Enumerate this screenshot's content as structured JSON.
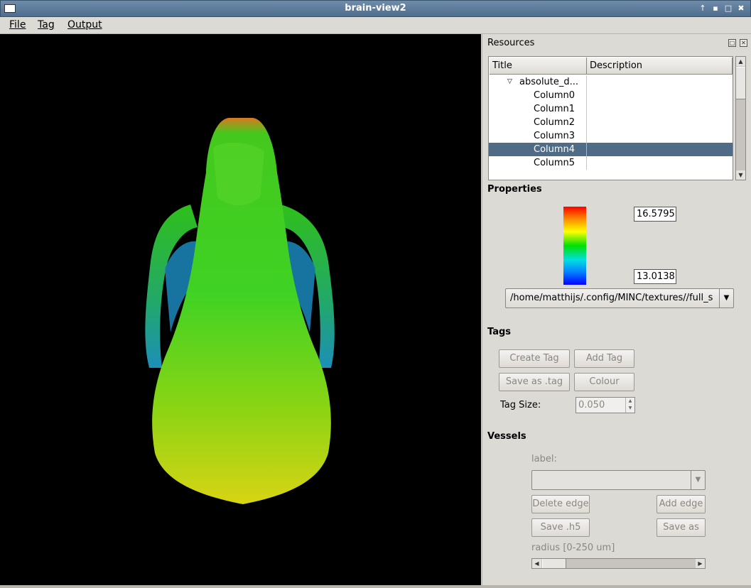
{
  "window": {
    "title": "brain-view2"
  },
  "menu": [
    {
      "label": "File"
    },
    {
      "label": "Tag"
    },
    {
      "label": "Output"
    }
  ],
  "resources": {
    "title": "Resources",
    "columns": [
      "Title",
      "Description"
    ],
    "tree": [
      {
        "label": "absolute_d...",
        "expanded": true
      },
      {
        "label": "Column0"
      },
      {
        "label": "Column1"
      },
      {
        "label": "Column2"
      },
      {
        "label": "Column3"
      },
      {
        "label": "Column4",
        "selected": true
      },
      {
        "label": "Column5"
      }
    ]
  },
  "properties": {
    "title": "Properties",
    "max_value": "16.5795",
    "min_value": "13.0138",
    "texture_path": "/home/matthijs/.config/MINC/textures//full_s"
  },
  "tags": {
    "title": "Tags",
    "create_tag": "Create Tag",
    "add_tag": "Add Tag",
    "save_tag": "Save as .tag",
    "colour": "Colour",
    "size_label": "Tag Size:",
    "size_value": "0.050"
  },
  "vessels": {
    "title": "Vessels",
    "label_caption": "label:",
    "label_value": "",
    "delete_edge": "Delete edge",
    "add_edge": "Add edge",
    "save_h5": "Save .h5",
    "save_as": "Save as",
    "radius_label": "radius [0-250 um]"
  },
  "colors": {
    "selection": "#4f6b85",
    "viewport_bg": "#000000",
    "panel_bg": "#dcdad5"
  }
}
